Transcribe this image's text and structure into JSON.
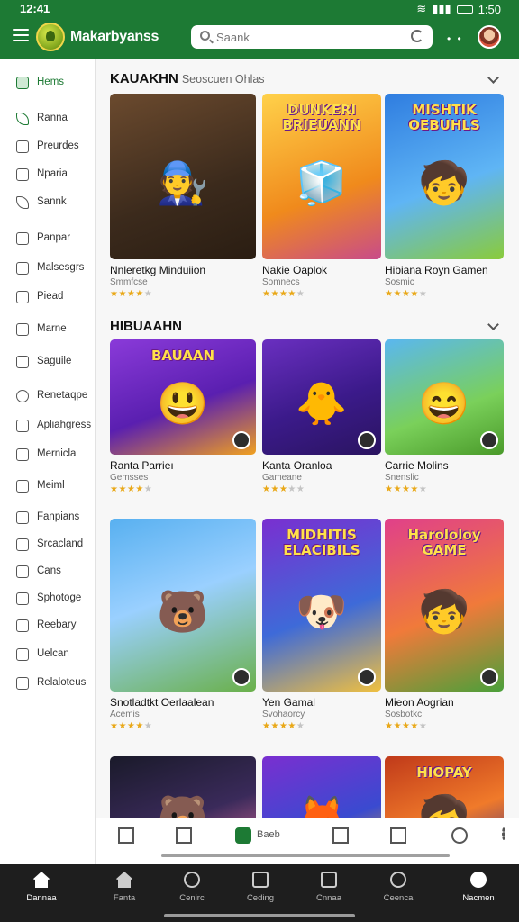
{
  "status": {
    "time": "12:41",
    "right_text": "1:50"
  },
  "app": {
    "title": "Makarbyanss"
  },
  "search": {
    "placeholder": "Saank"
  },
  "sidebar": {
    "items": [
      {
        "label": "Hems",
        "icon": "home-icon"
      },
      {
        "label": "Ranna",
        "icon": "leaf-icon"
      },
      {
        "label": "Preurdes",
        "icon": "tag-icon"
      },
      {
        "label": "Nparia",
        "icon": "ticket-icon"
      },
      {
        "label": "Sannk",
        "icon": "bolt-icon"
      },
      {
        "label": "Panpar",
        "icon": "calendar-icon"
      },
      {
        "label": "Malsesgrs",
        "icon": "document-icon"
      },
      {
        "label": "Piead",
        "icon": "folder-icon"
      },
      {
        "label": "Marne",
        "icon": "note-icon"
      },
      {
        "label": "Saguile",
        "icon": "box-icon"
      },
      {
        "label": "Renetaqpe",
        "icon": "search-icon"
      },
      {
        "label": "Apliahgress",
        "icon": "chart-icon"
      },
      {
        "label": "Mernicla",
        "icon": "shield-icon"
      },
      {
        "label": "Meiml",
        "icon": "mail-icon"
      },
      {
        "label": "Fanpians",
        "icon": "bookmark-icon"
      },
      {
        "label": "Srcacland",
        "icon": "grid-icon"
      },
      {
        "label": "Cans",
        "icon": "chat-icon"
      },
      {
        "label": "Sphotoge",
        "icon": "camera-icon"
      },
      {
        "label": "Reebary",
        "icon": "book-icon"
      },
      {
        "label": "Uelcan",
        "icon": "pen-icon"
      },
      {
        "label": "Relaloteus",
        "icon": "list-icon"
      }
    ]
  },
  "sections": [
    {
      "title": "KAUAKHN",
      "subtitle": "Seoscuen Ohlas"
    },
    {
      "title": "HIBUAAHN",
      "subtitle": ""
    }
  ],
  "cards": [
    {
      "title": "Nnleretkg Minduiion",
      "subtitle": "Smmfcse",
      "rating": 3.5,
      "glyph": "🧑‍🔧"
    },
    {
      "title": "Nakie Oaplok",
      "subtitle": "Somnecs",
      "rating": 3.5,
      "glyph": "🧊",
      "banner": "DUNKERI BRIEUANN"
    },
    {
      "title": "Hibiana Royn Gamen",
      "subtitle": "Sosmic",
      "rating": 3.5,
      "glyph": "🧒",
      "banner": "MISHTIK OEBUHLS"
    },
    {
      "title": "Ranta Parrieı",
      "subtitle": "Gemsses",
      "rating": 3.5,
      "glyph": "😃",
      "banner": "BAUAAN"
    },
    {
      "title": "Kanta Oranloa",
      "subtitle": "Gameane",
      "rating": 3,
      "glyph": "🐥"
    },
    {
      "title": "Carrie Molins",
      "subtitle": "Snenslic",
      "rating": 3.5,
      "glyph": "😄"
    },
    {
      "title": "Snotladtkt Oerlaalean",
      "subtitle": "Acemis",
      "rating": 3.5,
      "glyph": "🐻"
    },
    {
      "title": "Yen Gamal",
      "subtitle": "Svohaorcy",
      "rating": 3.5,
      "glyph": "🐶",
      "banner": "MIDHITIS ELACIBILS"
    },
    {
      "title": "Mieon Aogrian",
      "subtitle": "Sosbotkc",
      "rating": 3.5,
      "glyph": "🧒",
      "banner": "Harololoy GAME"
    },
    {
      "title": "",
      "subtitle": "",
      "rating": 0,
      "glyph": "🐻"
    },
    {
      "title": "",
      "subtitle": "",
      "rating": 0,
      "glyph": "🦊"
    },
    {
      "title": "",
      "subtitle": "",
      "rating": 0,
      "glyph": "🧒",
      "banner": "HIOPAY"
    }
  ],
  "tabs": [
    {
      "label": "",
      "icon": "home-icon"
    },
    {
      "label": "",
      "icon": "calendar-icon"
    },
    {
      "label": "Baeb",
      "icon": "search-icon"
    },
    {
      "label": "",
      "icon": "star-icon"
    },
    {
      "label": "",
      "icon": "list-icon"
    },
    {
      "label": "",
      "icon": "person-icon"
    },
    {
      "label": "",
      "icon": "more-icon"
    }
  ],
  "bottom_nav": [
    {
      "label": "Dannaa",
      "icon": "home-icon",
      "active": true
    },
    {
      "label": "Fanta",
      "icon": "house-icon",
      "active": false
    },
    {
      "label": "Cenirc",
      "icon": "person-icon",
      "active": false
    },
    {
      "label": "Ceding",
      "icon": "calendar-icon",
      "active": false
    },
    {
      "label": "Cnnaa",
      "icon": "box-icon",
      "active": false
    },
    {
      "label": "Ceenca",
      "icon": "search-icon",
      "active": false
    },
    {
      "label": "Nacmen",
      "icon": "profile-icon",
      "active": true
    }
  ],
  "colors": {
    "brand": "#1d7a34",
    "star": "#e9a818",
    "nav_bg": "#1e1e1e"
  }
}
